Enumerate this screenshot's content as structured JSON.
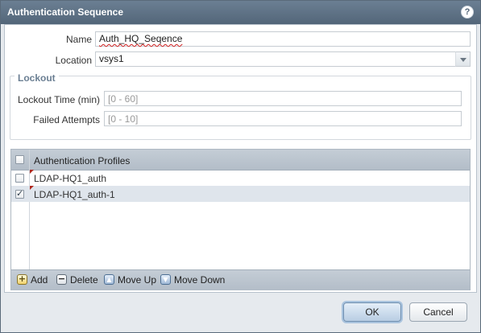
{
  "dialog": {
    "title": "Authentication Sequence",
    "help_icon": "question-circle-icon",
    "help_glyph": "?"
  },
  "form": {
    "name_label": "Name",
    "name_value": "Auth_HQ_Seqence",
    "location_label": "Location",
    "location_value": "vsys1"
  },
  "lockout": {
    "legend": "Lockout",
    "time_label": "Lockout Time (min)",
    "time_placeholder": "[0 - 60]",
    "attempts_label": "Failed Attempts",
    "attempts_placeholder": "[0 - 10]"
  },
  "profiles": {
    "header": "Authentication Profiles",
    "rows": [
      {
        "name": "LDAP-HQ1_auth",
        "checked": false
      },
      {
        "name": "LDAP-HQ1_auth-1",
        "checked": true
      }
    ]
  },
  "toolbar": {
    "add_label": "Add",
    "delete_label": "Delete",
    "move_up_label": "Move Up",
    "move_down_label": "Move Down"
  },
  "footer": {
    "ok_label": "OK",
    "cancel_label": "Cancel"
  },
  "colors": {
    "titlebar": "#536679",
    "accent": "#6b7f93"
  }
}
